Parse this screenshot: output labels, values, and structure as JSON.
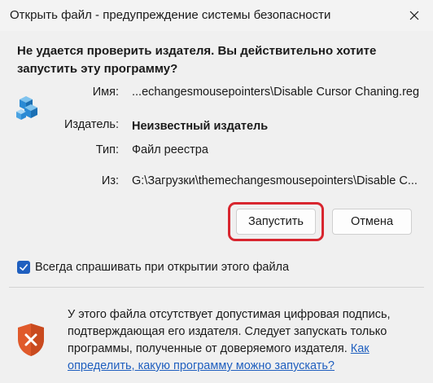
{
  "window": {
    "title": "Открыть файл - предупреждение системы безопасности"
  },
  "dialog": {
    "question": "Не удается проверить издателя.  Вы действительно хотите запустить эту программу?",
    "fields": {
      "name_label": "Имя:",
      "name_value": "...echangesmousepointers\\Disable Cursor Chaning.reg",
      "publisher_label": "Издатель:",
      "publisher_value": "Неизвестный издатель",
      "type_label": "Тип:",
      "type_value": "Файл реестра",
      "from_label": "Из:",
      "from_value": "G:\\Загрузки\\themechangesmousepointers\\Disable C..."
    },
    "buttons": {
      "run_label": "Запустить",
      "cancel_label": "Отмена"
    },
    "checkbox": {
      "label": "Всегда спрашивать при открытии этого файла",
      "checked": true
    },
    "warning": {
      "text": "У этого файла отсутствует допустимая цифровая подпись, подтверждающая его издателя.  Следует запускать только программы, полученные от доверяемого издателя. ",
      "link": "Как определить, какую программу можно запускать?"
    }
  },
  "icons": {
    "file_icon": "registry-file-icon",
    "warning_icon": "security-shield-icon",
    "close_icon": "close-icon"
  },
  "colors": {
    "accent": "#1f5fbf",
    "highlight": "#d8262f",
    "shield": "#e05a2b"
  }
}
